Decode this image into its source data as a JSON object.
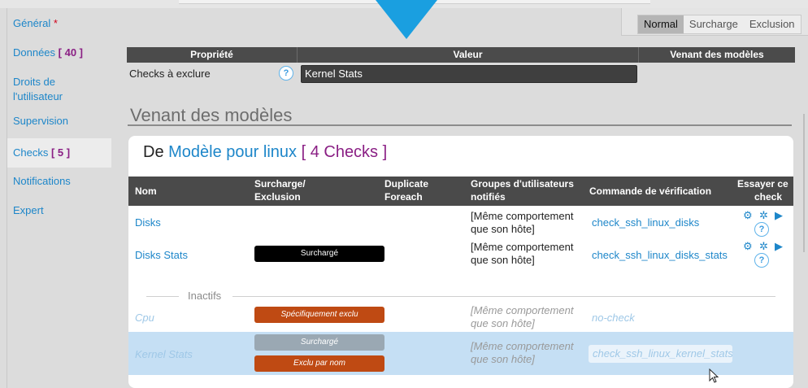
{
  "sidebar": {
    "items": [
      {
        "label": "Général",
        "marker": "*"
      },
      {
        "label": "Données",
        "badge": "[ 40 ]"
      },
      {
        "label_line1": "Droits de",
        "label_line2": "l'utilisateur"
      },
      {
        "label": "Supervision"
      },
      {
        "label": "Checks",
        "badge": "[ 5 ]"
      },
      {
        "label": "Notifications"
      },
      {
        "label": "Expert"
      }
    ]
  },
  "mode_toggle": {
    "options": [
      "Normal",
      "Surcharge",
      "Exclusion"
    ],
    "selected": "Normal"
  },
  "properties": {
    "headers": [
      "Propriété",
      "Valeur",
      "Venant des modèles"
    ],
    "rows": [
      {
        "label": "Checks à exclure",
        "help": "?",
        "value": "Kernel Stats"
      }
    ]
  },
  "from_models": {
    "title": "Venant des modèles"
  },
  "model_card": {
    "prefix": "De",
    "model_link": "Modèle pour linux",
    "count": "[ 4 Checks ]",
    "columns": {
      "name": "Nom",
      "override_1": "Surcharge/",
      "override_2": "Exclusion",
      "dup_1": "Duplicate",
      "dup_2": "Foreach",
      "groups_1": "Groupes d'utilisateurs",
      "groups_2": "notifiés",
      "command": "Commande de vérification",
      "try_1": "Essayer ce",
      "try_2": "check"
    },
    "active_rows": [
      {
        "name": "Disks",
        "override": "",
        "groups_1": "[Même comportement",
        "groups_2": "que son hôte]",
        "command": "check_ssh_linux_disks"
      },
      {
        "name": "Disks Stats",
        "override": "Surchargé",
        "groups_1": "[Même comportement",
        "groups_2": "que son hôte]",
        "command": "check_ssh_linux_disks_stats"
      }
    ],
    "inactive_label": "Inactifs",
    "inactive_rows": [
      {
        "name": "Cpu",
        "override": "Spécifiquement exclu",
        "groups_1": "[Même comportement",
        "groups_2": "que son hôte]",
        "command": "no-check"
      },
      {
        "name": "Kernel Stats",
        "override_top": "Surchargé",
        "override_bottom": "Exclu par nom",
        "groups_1": "[Même comportement",
        "groups_2": "que son hôte]",
        "command": "check_ssh_linux_kernel_stats"
      }
    ],
    "help": "?"
  },
  "colors": {
    "accent": "#1d86c9",
    "badge": "#8a1f84",
    "override_black": "#000000",
    "excluded_orange": "#bf4a13",
    "selected_row": "#c5dff4"
  }
}
